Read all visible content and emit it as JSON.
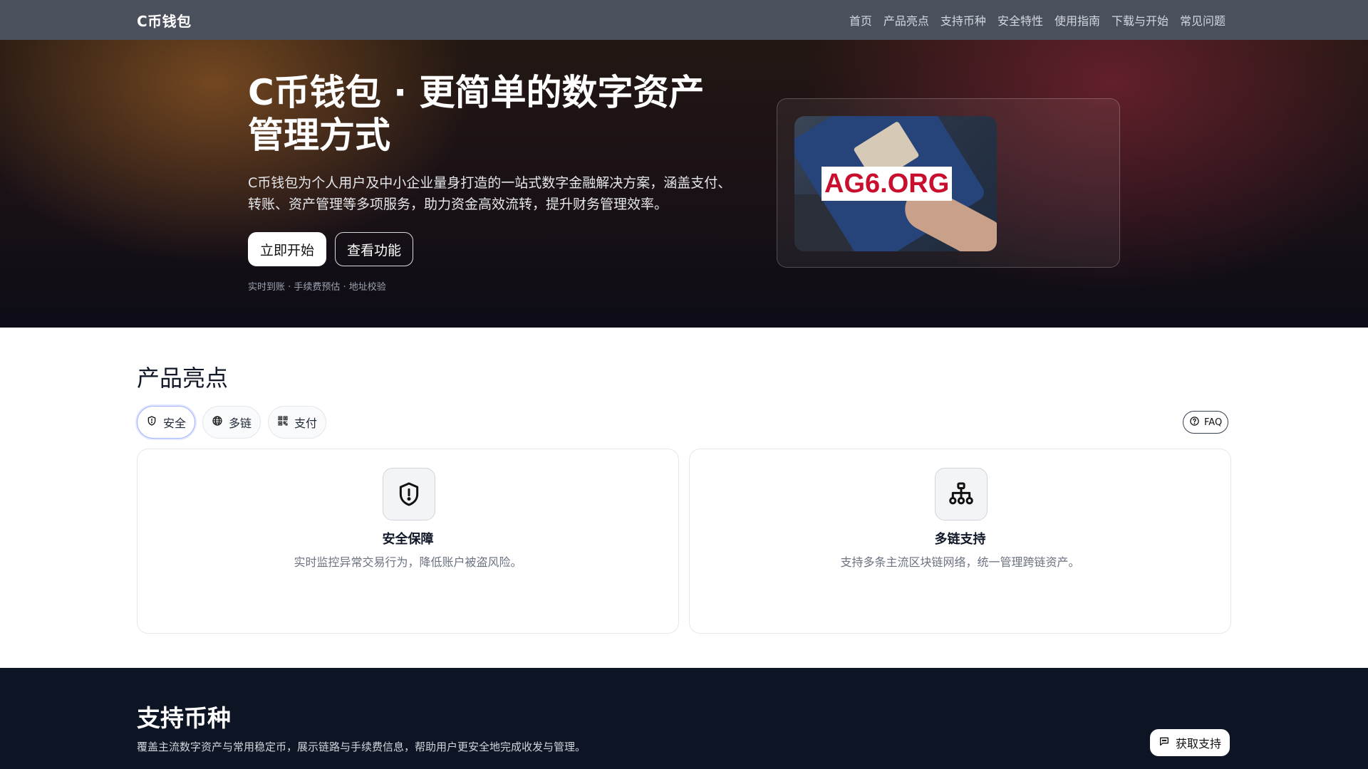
{
  "nav": {
    "brand": "C币钱包",
    "links": [
      "首页",
      "产品亮点",
      "支持币种",
      "安全特性",
      "使用指南",
      "下载与开始",
      "常见问题"
    ]
  },
  "hero": {
    "title": "C币钱包 · 更简单的数字资产管理方式",
    "description": "C币钱包为个人用户及中小企业量身打造的一站式数字金融解决方案，涵盖支付、转账、资产管理等多项服务，助力资金高效流转，提升财务管理效率。",
    "primary_button": "立即开始",
    "secondary_button": "查看功能",
    "note": "实时到账 · 手续费预估 · 地址校验",
    "image_watermark": "AG6.ORG"
  },
  "features": {
    "title": "产品亮点",
    "chips": [
      {
        "label": "安全",
        "icon": "shield-icon",
        "active": true
      },
      {
        "label": "多链",
        "icon": "globe-icon",
        "active": false
      },
      {
        "label": "支付",
        "icon": "qr-code-icon",
        "active": false
      }
    ],
    "faq_label": "FAQ",
    "cards": [
      {
        "title": "安全保障",
        "description": "实时监控异常交易行为，降低账户被盗风险。",
        "icon": "shield-alert-icon"
      },
      {
        "title": "多链支持",
        "description": "支持多条主流区块链网络，统一管理跨链资产。",
        "icon": "network-icon"
      }
    ]
  },
  "currencies": {
    "title": "支持币种",
    "description": "覆盖主流数字资产与常用稳定币，展示链路与手续费信息，帮助用户更安全地完成收发与管理。",
    "support_button": "获取支持"
  },
  "colors": {
    "nav_bg": "#4a505c",
    "dark_section_bg": "#0d1424",
    "watermark_red": "#c8102e"
  }
}
